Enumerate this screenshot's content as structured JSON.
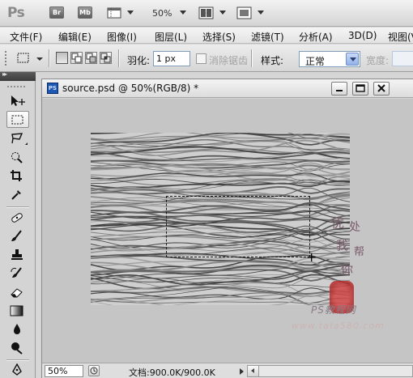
{
  "appbar": {
    "logo": "Ps",
    "bridge_label": "Br",
    "minibridge_label": "Mb",
    "zoom": "50%"
  },
  "menubar": {
    "items": [
      "文件(F)",
      "编辑(E)",
      "图像(I)",
      "图层(L)",
      "选择(S)",
      "滤镜(T)",
      "分析(A)",
      "3D(D)",
      "视图(V)"
    ]
  },
  "options": {
    "feather_label": "羽化:",
    "feather_value": "1 px",
    "antialias_label": "消除锯齿",
    "style_label": "样式:",
    "style_value": "正常",
    "width_label": "宽度:"
  },
  "tools": {
    "items": [
      "move",
      "rectangular-marquee",
      "lasso",
      "quick-selection",
      "crop",
      "eyedropper",
      "spot-healing-brush",
      "brush",
      "clone-stamp",
      "history-brush",
      "eraser",
      "gradient",
      "blur",
      "dodge",
      "pen"
    ],
    "active": "rectangular-marquee"
  },
  "document": {
    "title": "source.psd @ 50%(RGB/8) *",
    "file_icon": "PS",
    "zoom_field": "50%",
    "info": "文档:900.0K/900.0K",
    "watermark_chars": [
      "优",
      "处",
      "我",
      "帮",
      "你"
    ],
    "watermark_text": "PS教程网",
    "watermark_url": "www.tata580.com"
  },
  "colors": {
    "canvas_bg": "#c5c5c5",
    "accent": "#1d58b5",
    "seal": "#c23434"
  }
}
